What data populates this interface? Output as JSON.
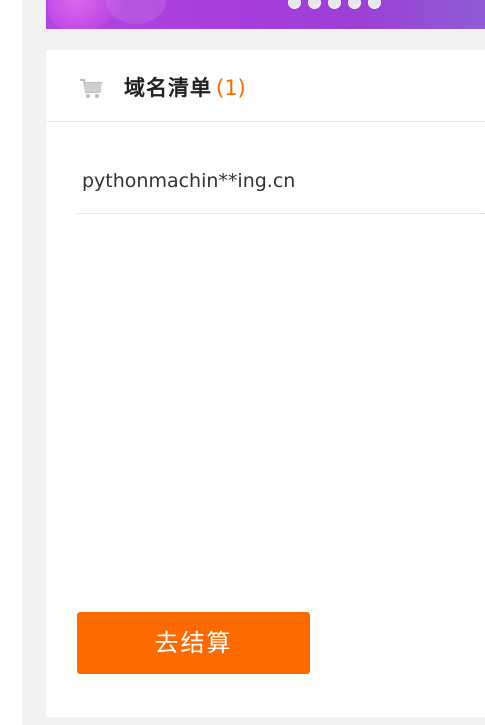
{
  "banner": {
    "dot_count": 5
  },
  "cart": {
    "title": "域名清单",
    "count": "(1)",
    "items": [
      {
        "domain": "pythonmachin**ing.cn"
      }
    ],
    "checkout_label": "去结算"
  },
  "colors": {
    "accent": "#ff6a00",
    "page_bg": "#f2f2f2"
  },
  "icons": {
    "cart": "shopping-cart-icon"
  }
}
